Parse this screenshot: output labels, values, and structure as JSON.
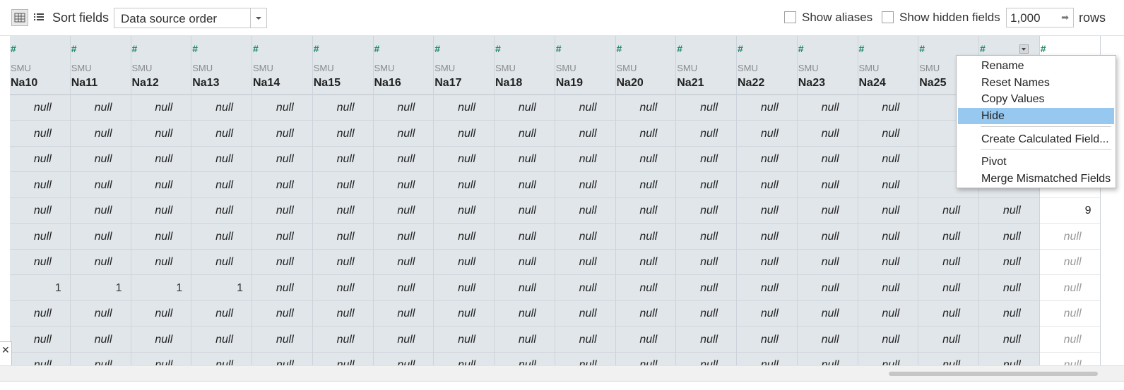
{
  "toolbar": {
    "grid_view_icon": "grid-icon",
    "list_view_icon": "list-icon",
    "sort_label": "Sort fields",
    "sort_value": "Data source order",
    "show_aliases_label": "Show aliases",
    "show_hidden_label": "Show hidden fields",
    "rows_value": "1,000",
    "rows_label": "rows"
  },
  "columns": [
    {
      "type_icon": "#",
      "source": "SMU",
      "name": "Na10",
      "cells": [
        "null",
        "null",
        "null",
        "null",
        "null",
        "null",
        "null",
        "1",
        "null",
        "null",
        "null"
      ]
    },
    {
      "type_icon": "#",
      "source": "SMU",
      "name": "Na11",
      "cells": [
        "null",
        "null",
        "null",
        "null",
        "null",
        "null",
        "null",
        "1",
        "null",
        "null",
        "null"
      ]
    },
    {
      "type_icon": "#",
      "source": "SMU",
      "name": "Na12",
      "cells": [
        "null",
        "null",
        "null",
        "null",
        "null",
        "null",
        "null",
        "1",
        "null",
        "null",
        "null"
      ]
    },
    {
      "type_icon": "#",
      "source": "SMU",
      "name": "Na13",
      "cells": [
        "null",
        "null",
        "null",
        "null",
        "null",
        "null",
        "null",
        "1",
        "null",
        "null",
        "null"
      ]
    },
    {
      "type_icon": "#",
      "source": "SMU",
      "name": "Na14",
      "cells": [
        "null",
        "null",
        "null",
        "null",
        "null",
        "null",
        "null",
        "null",
        "null",
        "null",
        "null"
      ]
    },
    {
      "type_icon": "#",
      "source": "SMU",
      "name": "Na15",
      "cells": [
        "null",
        "null",
        "null",
        "null",
        "null",
        "null",
        "null",
        "null",
        "null",
        "null",
        "null"
      ]
    },
    {
      "type_icon": "#",
      "source": "SMU",
      "name": "Na16",
      "cells": [
        "null",
        "null",
        "null",
        "null",
        "null",
        "null",
        "null",
        "null",
        "null",
        "null",
        "null"
      ]
    },
    {
      "type_icon": "#",
      "source": "SMU",
      "name": "Na17",
      "cells": [
        "null",
        "null",
        "null",
        "null",
        "null",
        "null",
        "null",
        "null",
        "null",
        "null",
        "null"
      ]
    },
    {
      "type_icon": "#",
      "source": "SMU",
      "name": "Na18",
      "cells": [
        "null",
        "null",
        "null",
        "null",
        "null",
        "null",
        "null",
        "null",
        "null",
        "null",
        "null"
      ]
    },
    {
      "type_icon": "#",
      "source": "SMU",
      "name": "Na19",
      "cells": [
        "null",
        "null",
        "null",
        "null",
        "null",
        "null",
        "null",
        "null",
        "null",
        "null",
        "null"
      ]
    },
    {
      "type_icon": "#",
      "source": "SMU",
      "name": "Na20",
      "cells": [
        "null",
        "null",
        "null",
        "null",
        "null",
        "null",
        "null",
        "null",
        "null",
        "null",
        "null"
      ]
    },
    {
      "type_icon": "#",
      "source": "SMU",
      "name": "Na21",
      "cells": [
        "null",
        "null",
        "null",
        "null",
        "null",
        "null",
        "null",
        "null",
        "null",
        "null",
        "null"
      ]
    },
    {
      "type_icon": "#",
      "source": "SMU",
      "name": "Na22",
      "cells": [
        "null",
        "null",
        "null",
        "null",
        "null",
        "null",
        "null",
        "null",
        "null",
        "null",
        "null"
      ]
    },
    {
      "type_icon": "#",
      "source": "SMU",
      "name": "Na23",
      "cells": [
        "null",
        "null",
        "null",
        "null",
        "null",
        "null",
        "null",
        "null",
        "null",
        "null",
        "null"
      ]
    },
    {
      "type_icon": "#",
      "source": "SMU",
      "name": "Na24",
      "cells": [
        "null",
        "null",
        "null",
        "null",
        "null",
        "null",
        "null",
        "null",
        "null",
        "null",
        "null"
      ]
    },
    {
      "type_icon": "#",
      "source": "SMU",
      "name": "Na25",
      "cells": [
        "",
        "",
        "",
        "",
        "null",
        "null",
        "null",
        "null",
        "null",
        "null",
        "null"
      ]
    },
    {
      "type_icon": "#",
      "source": "",
      "name": "",
      "cells": [
        "",
        "",
        "",
        "",
        "null",
        "null",
        "null",
        "null",
        "null",
        "null",
        "null"
      ],
      "has_menu_arrow": true
    },
    {
      "type_icon": "#",
      "source": "",
      "name": "",
      "cells": [
        "",
        "",
        "",
        "",
        "9",
        "null",
        "null",
        "null",
        "null",
        "null",
        "null"
      ],
      "white": true
    }
  ],
  "context_menu": {
    "items": [
      "Rename",
      "Reset Names",
      "Copy Values",
      "Hide",
      "Create Calculated Field...",
      "Pivot",
      "Merge Mismatched Fields"
    ],
    "highlighted": "Hide"
  },
  "close_glyph": "✕",
  "colors": {
    "accent_blue": "#4f93c7",
    "measure_green": "#1d8a67",
    "menu_highlight": "#96c8f0",
    "column_bg": "#e1e6ea"
  }
}
